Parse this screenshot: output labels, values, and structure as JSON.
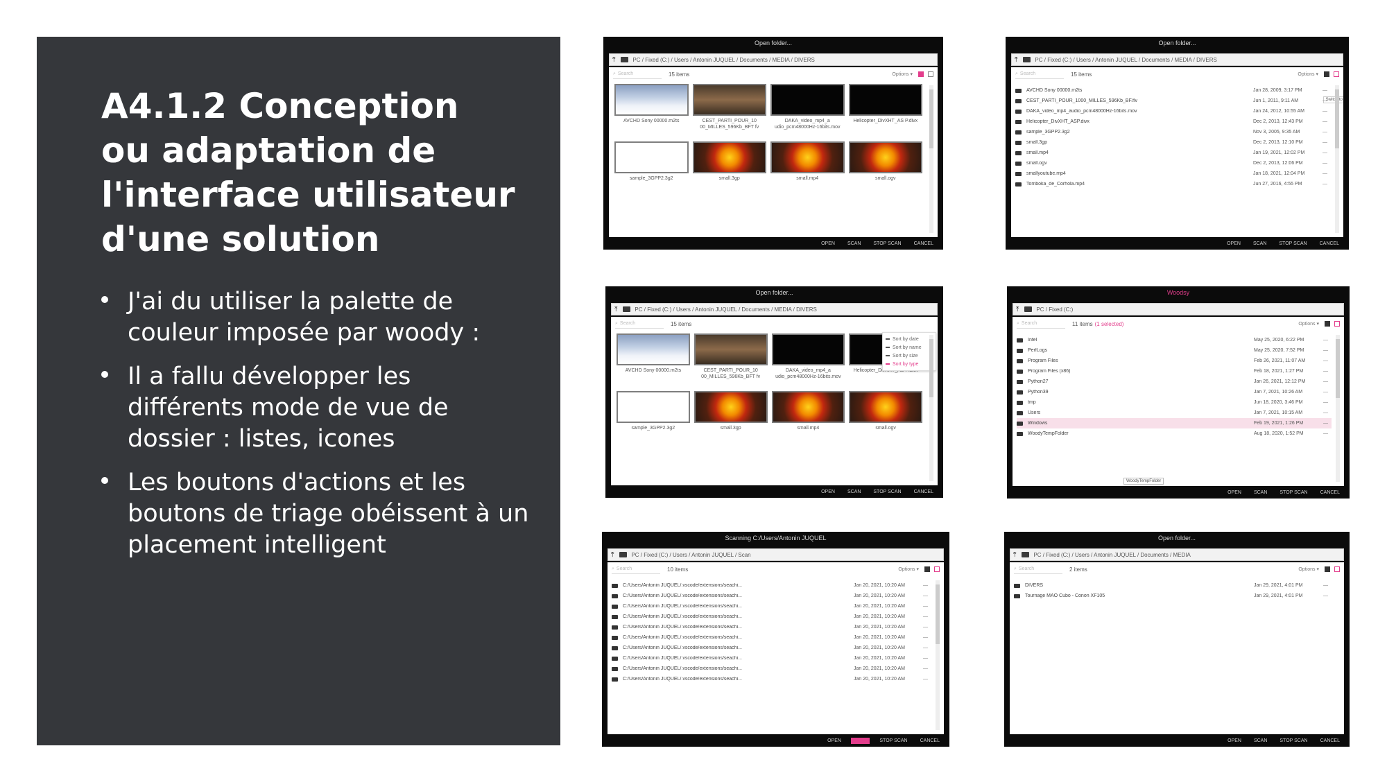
{
  "slide": {
    "title": "A4.1.2 Conception ou adaptation de l'interface utilisateur d'une solution",
    "bullets": [
      "J'ai du utiliser la palette de couleur imposée par woody :",
      "Il a fallu développer les différents mode de vue de dossier : listes, icones",
      "Les boutons d'actions et les boutons de triage obéissent à un placement intelligent"
    ]
  },
  "colors": {
    "panel": "#35373b",
    "accent": "#e33d8c",
    "window": "#0b0b0b"
  },
  "common": {
    "search_placeholder": "Search",
    "options_label": "Options ▾",
    "buttons": {
      "open": "OPEN",
      "scan": "SCAN",
      "stop_scan": "STOP SCAN",
      "cancel": "CANCEL"
    }
  },
  "win1": {
    "title": "Open folder...",
    "path": "PC  /  Fixed (C:)  /  Users  /  Antonin JUQUEL  /  Documents  /  MEDIA  /  DIVERS",
    "count": "15 items",
    "tiles": [
      "AVCHD Sony 00000.m2ts",
      "CEST_PARTI_POUR_10 00_MILLES_596Kb_BFT fv",
      "DAKA_video_mp4_a udio_pcm48000Hz-16bits.mov",
      "Helicopter_DivXHT_AS P.divx",
      "sample_3GPP2.3g2",
      "small.3gp",
      "small.mp4",
      "small.ogv"
    ]
  },
  "win2": {
    "title": "Open folder...",
    "path": "PC  /  Fixed (C:)  /  Users  /  Antonin JUQUEL  /  Documents  /  MEDIA  /  DIVERS",
    "count": "15 items",
    "tooltip": "Switch to list",
    "rows": [
      {
        "name": "AVCHD Sony 00000.m2ts",
        "date": "Jan 28, 2009, 3:17 PM"
      },
      {
        "name": "CEST_PARTI_POUR_1000_MILLES_596Kb_BF.flv",
        "date": "Jun 1, 2011, 9:11 AM"
      },
      {
        "name": "DAKA_video_mp4_audio_pcm48000Hz-16bits.mov",
        "date": "Jan 24, 2012, 10:55 AM"
      },
      {
        "name": "Helicopter_DivXHT_ASP.divx",
        "date": "Dec 2, 2013, 12:43 PM"
      },
      {
        "name": "sample_3GPP2.3g2",
        "date": "Nov 3, 2005, 9:35 AM"
      },
      {
        "name": "small.3gp",
        "date": "Dec 2, 2013, 12:10 PM"
      },
      {
        "name": "small.mp4",
        "date": "Jan 19, 2021, 12:02 PM"
      },
      {
        "name": "small.ogv",
        "date": "Dec 2, 2013, 12:06 PM"
      },
      {
        "name": "smallyoutube.mp4",
        "date": "Jan 18, 2021, 12:04 PM"
      },
      {
        "name": "Tomboka_de_Corhola.mp4",
        "date": "Jun 27, 2016, 4:55 PM"
      }
    ]
  },
  "win3": {
    "title": "Open folder...",
    "path": "PC  /  Fixed (C:)  /  Users  /  Antonin JUQUEL  /  Documents  /  MEDIA  /  DIVERS",
    "count": "15 items",
    "sort_menu": [
      "Sort by date",
      "Sort by name",
      "Sort by size",
      "Sort by type"
    ],
    "tiles": [
      "AVCHD Sony 00000.m2ts",
      "CEST_PARTI_POUR_10 00_MILLES_596Kb_BFT fv",
      "DAKA_video_mp4_a udio_pcm48000Hz-16bits.mov",
      "Helicopter_DivXHT_AS P.divx",
      "sample_3GPP2.3g2",
      "small.3gp",
      "small.mp4",
      "small.ogv"
    ]
  },
  "win4": {
    "title": "Woodsy",
    "path": "PC  /  Fixed (C:)",
    "count": "11 items",
    "selected": "(1 selected)",
    "tooltip": "WoodyTempFolder",
    "rows": [
      {
        "name": "Intel",
        "date": "May 25, 2020, 6:22 PM"
      },
      {
        "name": "PerfLogs",
        "date": "May 25, 2020, 7:52 PM"
      },
      {
        "name": "Program Files",
        "date": "Feb 26, 2021, 11:07 AM"
      },
      {
        "name": "Program Files (x86)",
        "date": "Feb 18, 2021, 1:27 PM"
      },
      {
        "name": "Python27",
        "date": "Jan 26, 2021, 12:12 PM"
      },
      {
        "name": "Python39",
        "date": "Jan 7, 2021, 10:26 AM"
      },
      {
        "name": "tmp",
        "date": "Jun 18, 2020, 3:46 PM"
      },
      {
        "name": "Users",
        "date": "Jan 7, 2021, 10:15 AM"
      },
      {
        "name": "Windows",
        "date": "Feb 19, 2021, 1:26 PM"
      },
      {
        "name": "WoodyTempFolder",
        "date": "Aug 18, 2020, 1:52 PM"
      }
    ]
  },
  "win5": {
    "title": "Scanning C:/Users/Antonin JUQUEL",
    "path": "PC  /  Fixed (C:)  /  Users  /  Antonin JUQUEL  /  Scan",
    "count": "10 items",
    "rows": [
      {
        "name": "C:/Users/Antonin JUQUEL/.vscode/extensions/seachi...",
        "date": "Jan 20, 2021, 10:20 AM"
      },
      {
        "name": "C:/Users/Antonin JUQUEL/.vscode/extensions/seachi...",
        "date": "Jan 20, 2021, 10:20 AM"
      },
      {
        "name": "C:/Users/Antonin JUQUEL/.vscode/extensions/seachi...",
        "date": "Jan 20, 2021, 10:20 AM"
      },
      {
        "name": "C:/Users/Antonin JUQUEL/.vscode/extensions/seachi...",
        "date": "Jan 20, 2021, 10:20 AM"
      },
      {
        "name": "C:/Users/Antonin JUQUEL/.vscode/extensions/seachi...",
        "date": "Jan 20, 2021, 10:20 AM"
      },
      {
        "name": "C:/Users/Antonin JUQUEL/.vscode/extensions/seachi...",
        "date": "Jan 20, 2021, 10:20 AM"
      },
      {
        "name": "C:/Users/Antonin JUQUEL/.vscode/extensions/seachi...",
        "date": "Jan 20, 2021, 10:20 AM"
      },
      {
        "name": "C:/Users/Antonin JUQUEL/.vscode/extensions/seachi...",
        "date": "Jan 20, 2021, 10:20 AM"
      },
      {
        "name": "C:/Users/Antonin JUQUEL/.vscode/extensions/seachi...",
        "date": "Jan 20, 2021, 10:20 AM"
      },
      {
        "name": "C:/Users/Antonin JUQUEL/.vscode/extensions/seachi...",
        "date": "Jan 20, 2021, 10:20 AM"
      }
    ]
  },
  "win6": {
    "title": "Open folder...",
    "path": "PC  /  Fixed (C:)  /  Users  /  Antonin JUQUEL  /  Documents  /  MEDIA",
    "count": "2 items",
    "rows": [
      {
        "name": "DIVERS",
        "date": "Jan 29, 2021, 4:01 PM"
      },
      {
        "name": "Tournage MAO Cubo - Conon XF105",
        "date": "Jan 29, 2021, 4:01 PM"
      }
    ]
  }
}
